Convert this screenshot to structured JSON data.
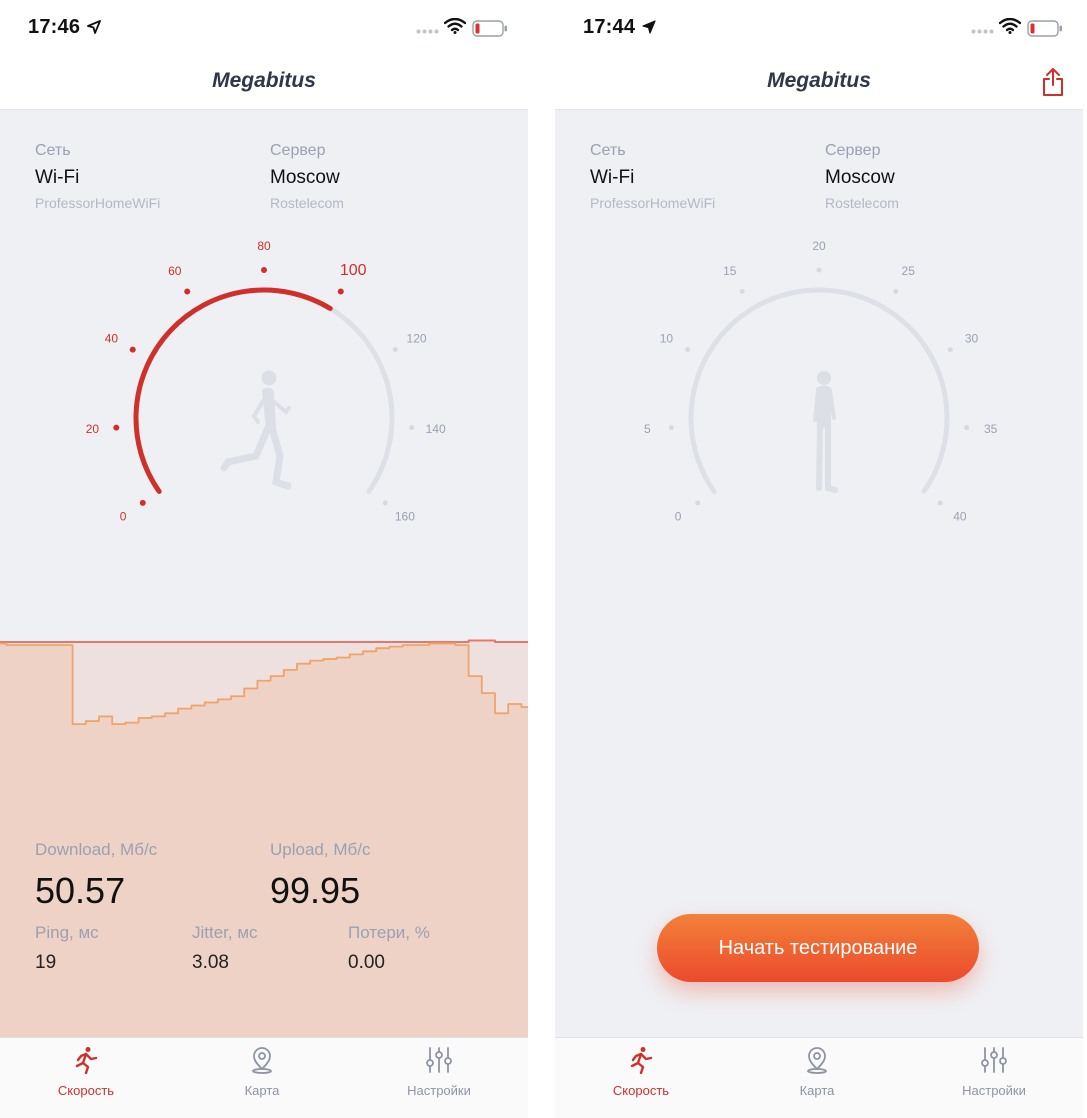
{
  "colors": {
    "accent": "#d0302a",
    "chart_upload": "#e8776a",
    "chart_download": "#f0a46a",
    "button_gradient_top": "#f2813a",
    "button_gradient_bottom": "#ec4a2c",
    "gauge_track": "#dde0e6"
  },
  "screens": [
    {
      "status_bar": {
        "time": "17:46",
        "icons": [
          "location-arrow-icon",
          "signal-icon",
          "wifi-icon",
          "battery-low-icon"
        ]
      },
      "nav": {
        "title": "Megabitus"
      },
      "network": {
        "label": "Сеть",
        "value": "Wi-Fi",
        "sub": "ProfessorHomeWiFi"
      },
      "server": {
        "label": "Сервер",
        "value": "Moscow",
        "sub": "Rostelecom"
      },
      "gauge": {
        "ticks": [
          "0",
          "20",
          "40",
          "60",
          "80",
          "100",
          "120",
          "140",
          "160"
        ],
        "max": 160,
        "value": 99.95,
        "icon": "runner-icon"
      },
      "chart_data": {
        "type": "line",
        "title": "",
        "xlabel": "",
        "ylabel": "",
        "grid": false,
        "x": [
          0,
          1,
          2,
          3,
          4,
          5,
          6,
          7,
          8,
          9,
          10,
          11,
          12,
          13,
          14,
          15,
          16,
          17,
          18,
          19,
          20,
          21,
          22,
          23,
          24,
          25,
          26,
          27,
          28,
          29,
          30,
          31,
          32,
          33,
          34,
          35,
          36,
          37,
          38,
          39,
          40
        ],
        "ylim": [
          0,
          160
        ],
        "series": [
          {
            "values": [
              100,
              100,
              100,
              100,
              100,
              100,
              100,
              100,
              100,
              100,
              100,
              100,
              100,
              100,
              100,
              100,
              100,
              100,
              100,
              100,
              100,
              100,
              100,
              100,
              100,
              100,
              100,
              100,
              100,
              100,
              100,
              100,
              100,
              100,
              100,
              100,
              101,
              101,
              100,
              100,
              100
            ]
          },
          {
            "values": [
              99,
              98,
              98,
              98,
              98,
              98,
              47,
              49,
              52,
              47,
              48,
              51,
              52,
              54,
              57,
              59,
              61,
              63,
              65,
              70,
              75,
              78,
              82,
              86,
              88,
              89,
              90,
              92,
              94,
              96,
              97,
              98,
              98,
              99,
              99,
              98,
              78,
              67,
              54,
              60,
              58
            ]
          }
        ]
      },
      "metrics": {
        "download": {
          "label": "Download, Мб/с",
          "value": "50.57"
        },
        "upload": {
          "label": "Upload, Мб/с",
          "value": "99.95"
        },
        "ping": {
          "label": "Ping, мс",
          "value": "19"
        },
        "jitter": {
          "label": "Jitter, мс",
          "value": "3.08"
        },
        "loss": {
          "label": "Потери, %",
          "value": "0.00"
        }
      },
      "tabs": [
        {
          "label": "Скорость",
          "icon": "runner-icon",
          "active": true
        },
        {
          "label": "Карта",
          "icon": "map-pin-icon",
          "active": false
        },
        {
          "label": "Настройки",
          "icon": "sliders-icon",
          "active": false
        }
      ]
    },
    {
      "status_bar": {
        "time": "17:44",
        "icons": [
          "location-arrow-icon",
          "signal-icon",
          "wifi-icon",
          "battery-low-icon"
        ]
      },
      "nav": {
        "title": "Megabitus",
        "share_icon": "share-icon"
      },
      "network": {
        "label": "Сеть",
        "value": "Wi-Fi",
        "sub": "ProfessorHomeWiFi"
      },
      "server": {
        "label": "Сервер",
        "value": "Moscow",
        "sub": "Rostelecom"
      },
      "gauge": {
        "ticks": [
          "0",
          "5",
          "10",
          "15",
          "20",
          "25",
          "30",
          "35",
          "40"
        ],
        "max": 40,
        "value": 0,
        "icon": "standing-person-icon"
      },
      "start_button": {
        "label": "Начать тестирование"
      },
      "tabs": [
        {
          "label": "Скорость",
          "icon": "runner-icon",
          "active": true
        },
        {
          "label": "Карта",
          "icon": "map-pin-icon",
          "active": false
        },
        {
          "label": "Настройки",
          "icon": "sliders-icon",
          "active": false
        }
      ]
    }
  ]
}
